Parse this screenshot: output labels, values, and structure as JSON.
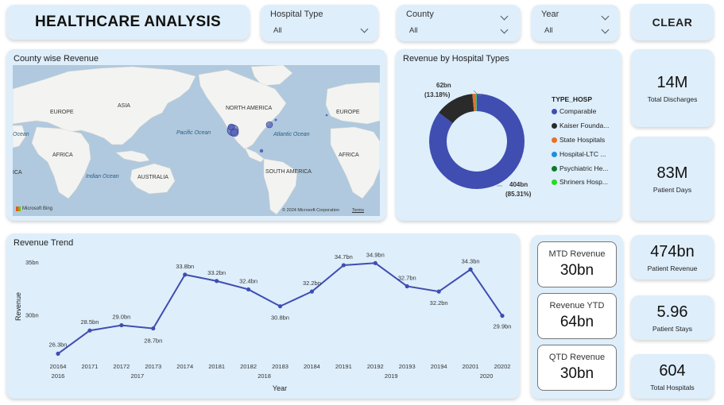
{
  "dashboard_title": "HEALTHCARE ANALYSIS",
  "slicers": {
    "hospital_type": {
      "label": "Hospital Type",
      "value": "All"
    },
    "county": {
      "label": "County",
      "value": "All"
    },
    "year": {
      "label": "Year",
      "value": "All"
    }
  },
  "clear_label": "CLEAR",
  "map": {
    "title": "County wise Revenue",
    "labels": [
      "EUROPE",
      "ASIA",
      "NORTH AMERICA",
      "EUROPE",
      "AFRICA",
      "AUSTRALIA",
      "SOUTH AMERICA",
      "AFRICA",
      "ICA"
    ],
    "oceans": [
      "Pacific Ocean",
      "Atlantic Ocean",
      "Indian Ocean",
      "Ocean",
      "Indian Ocean"
    ],
    "bing": "Microsoft Bing",
    "copyright": "© 2024 Microsoft Corporation",
    "terms": "Terms"
  },
  "donut": {
    "title": "Revenue by Hospital Types",
    "legend_title": "TYPE_HOSP",
    "legend": [
      {
        "label": "Comparable",
        "color": "#3f4eb0"
      },
      {
        "label": "Kaiser Founda...",
        "color": "#2a2a2a"
      },
      {
        "label": "State Hospitals",
        "color": "#e8702a"
      },
      {
        "label": "Hospital-LTC ...",
        "color": "#1f8fd8"
      },
      {
        "label": "Psychiatric He...",
        "color": "#0a7a2a"
      },
      {
        "label": "Shriners Hosp...",
        "color": "#22dd22"
      }
    ],
    "label_small_value": "62bn",
    "label_small_pct": "(13.18%)",
    "label_large_value": "404bn",
    "label_large_pct": "(85.31%)"
  },
  "kpis": {
    "discharges": {
      "value": "14M",
      "label": "Total Discharges"
    },
    "patient_days": {
      "value": "83M",
      "label": "Patient Days"
    },
    "patient_revenue": {
      "value": "474bn",
      "label": "Patient Revenue"
    },
    "patient_stays": {
      "value": "5.96",
      "label": "Patient Stays"
    },
    "total_hospitals": {
      "value": "604",
      "label": "Total Hospitals"
    }
  },
  "revenue_cards": {
    "mtd": {
      "label": "MTD Revenue",
      "value": "30bn"
    },
    "ytd": {
      "label": "Revenue YTD",
      "value": "64bn"
    },
    "qtd": {
      "label": "QTD Revenue",
      "value": "30bn"
    }
  },
  "chart_data": [
    {
      "type": "pie",
      "title": "Revenue by Hospital Types",
      "legend_title": "TYPE_HOSP",
      "legend_position": "right",
      "categories": [
        "Comparable",
        "Kaiser Founda...",
        "State Hospitals",
        "Hospital-LTC ...",
        "Psychiatric He...",
        "Shriners Hosp..."
      ],
      "values": [
        85.31,
        13.18,
        1.2,
        0.1,
        0.1,
        0.11
      ],
      "colors": [
        "#3f4eb0",
        "#2a2a2a",
        "#e8702a",
        "#1f8fd8",
        "#0a7a2a",
        "#22dd22"
      ]
    },
    {
      "type": "line",
      "title": "Revenue Trend",
      "xlabel": "Year",
      "ylabel": "Revenue",
      "categories": [
        "20164",
        "20171",
        "20172",
        "20173",
        "20174",
        "20181",
        "20182",
        "20183",
        "20184",
        "20191",
        "20192",
        "20193",
        "20194",
        "20201",
        "20202"
      ],
      "year_groups": [
        {
          "year": "2016",
          "from": 0,
          "to": 0
        },
        {
          "year": "2017",
          "from": 1,
          "to": 4
        },
        {
          "year": "2018",
          "from": 5,
          "to": 8
        },
        {
          "year": "2019",
          "from": 9,
          "to": 12
        },
        {
          "year": "2020",
          "from": 13,
          "to": 14
        }
      ],
      "values": [
        26.3,
        28.5,
        29.0,
        28.7,
        33.8,
        33.2,
        32.4,
        30.8,
        32.2,
        34.7,
        34.9,
        32.7,
        32.2,
        34.3,
        29.9
      ],
      "value_labels": [
        "26.3bn",
        "28.5bn",
        "29.0bn",
        "28.7bn",
        "33.8bn",
        "33.2bn",
        "32.4bn",
        "30.8bn",
        "32.2bn",
        "34.7bn",
        "34.9bn",
        "32.7bn",
        "32.2bn",
        "34.3bn",
        "29.9bn"
      ],
      "yticks": [
        {
          "value": 35,
          "label": "35bn"
        },
        {
          "value": 30,
          "label": "30bn"
        }
      ],
      "ylim": [
        25.2,
        35.6
      ],
      "grid": false,
      "color": "#3f4eb0"
    }
  ]
}
